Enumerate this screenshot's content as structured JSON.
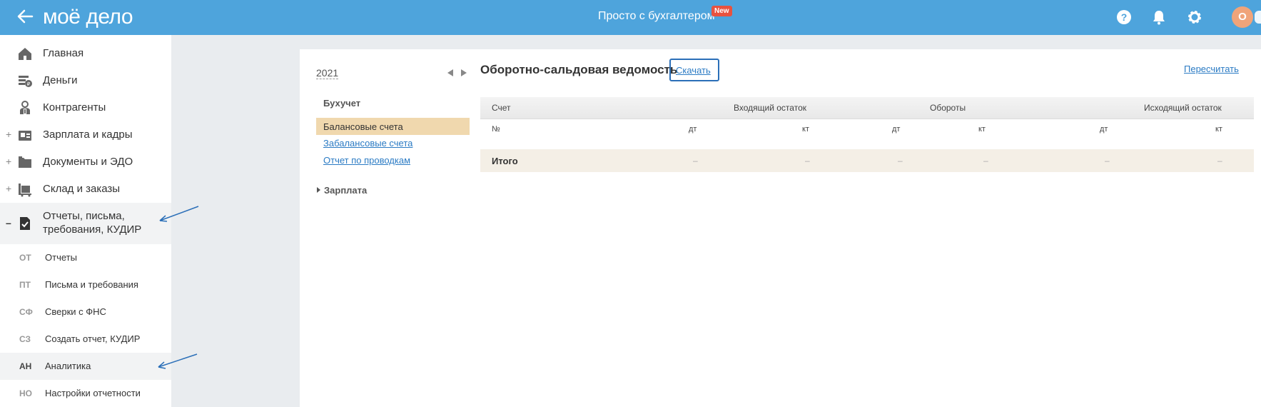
{
  "header": {
    "logo_text": "моё дело",
    "center_title": "Просто с бухгалтером",
    "new_badge": "New",
    "avatar_letter": "О",
    "colors": {
      "background": "#4ea4dc",
      "badge": "#e8523f",
      "avatar": "#f0a47a"
    },
    "icons": [
      "back-arrow-icon",
      "help-icon",
      "bell-icon",
      "gear-icon"
    ]
  },
  "sidebar": {
    "items": [
      {
        "label": "Главная",
        "icon": "home-icon",
        "expandable": false
      },
      {
        "label": "Деньги",
        "icon": "money-icon",
        "expandable": false
      },
      {
        "label": "Контрагенты",
        "icon": "contractor-icon",
        "expandable": false
      },
      {
        "label": "Зарплата и кадры",
        "icon": "salary-icon",
        "expandable": true,
        "toggle": "+"
      },
      {
        "label": "Документы и ЭДО",
        "icon": "folder-icon",
        "expandable": true,
        "toggle": "+"
      },
      {
        "label": "Склад и заказы",
        "icon": "warehouse-icon",
        "expandable": true,
        "toggle": "+"
      },
      {
        "label_line1": "Отчеты, письма,",
        "label_line2": "требования, КУДИР",
        "icon": "report-icon",
        "expandable": true,
        "toggle": "–",
        "open": true
      }
    ],
    "subitems": [
      {
        "abbr": "ОТ",
        "label": "Отчеты"
      },
      {
        "abbr": "ПТ",
        "label": "Письма и требования"
      },
      {
        "abbr": "СФ",
        "label": "Сверки с ФНС"
      },
      {
        "abbr": "СЗ",
        "label": "Создать отчет, КУДИР"
      },
      {
        "abbr": "АН",
        "label": "Аналитика",
        "active": true
      },
      {
        "abbr": "НО",
        "label": "Настройки отчетности"
      }
    ]
  },
  "left_panel": {
    "year": "2021",
    "section_title": "Бухучет",
    "active_item": "Балансовые счета",
    "links": [
      "Забалансовые счета",
      "Отчет по проводкам"
    ],
    "group": "Зарплата"
  },
  "report": {
    "title": "Оборотно-сальдовая ведомость",
    "download_label": "Скачать",
    "recalc_label": "Пересчитать",
    "table": {
      "headers": [
        "Счет",
        "Входящий остаток",
        "Обороты",
        "Исходящий остаток"
      ],
      "sub_headers": [
        "№",
        "дт",
        "кт",
        "дт",
        "кт",
        "дт",
        "кт"
      ],
      "total_label": "Итого",
      "total_values": [
        "–",
        "–",
        "–",
        "–",
        "–",
        "–"
      ]
    }
  }
}
